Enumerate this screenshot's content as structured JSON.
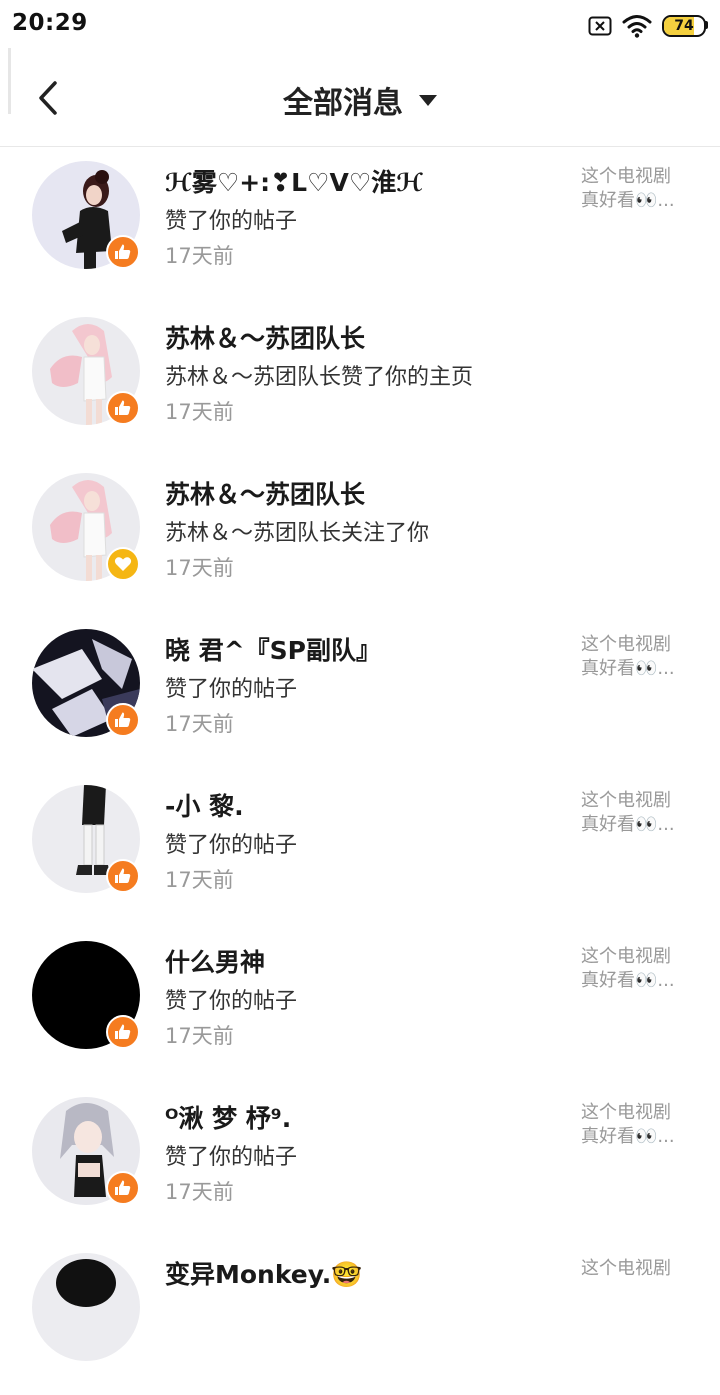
{
  "status_bar": {
    "time": "20:29",
    "battery_level": "74",
    "battery_fraction": 0.74
  },
  "header": {
    "title": "全部消息"
  },
  "colors": {
    "like_badge": "#f57c20",
    "follow_badge": "#f5b614"
  },
  "messages": [
    {
      "name": "ℋ雾♡+:❣L♡V♡淮ℋ",
      "action": "赞了你的帖子",
      "time": "17天前",
      "badge": "thumbs-up-icon",
      "preview_line1": "这个电视剧",
      "preview_line2": "真好看👀..."
    },
    {
      "name": "苏林＆～苏团队长",
      "action": "苏林＆～苏团队长赞了你的主页",
      "time": "17天前",
      "badge": "thumbs-up-icon",
      "preview_line1": "",
      "preview_line2": ""
    },
    {
      "name": "苏林＆～苏团队长",
      "action": "苏林＆～苏团队长关注了你",
      "time": "17天前",
      "badge": "heart-icon",
      "preview_line1": "",
      "preview_line2": ""
    },
    {
      "name": "晓 君^『SP副队』",
      "action": "赞了你的帖子",
      "time": "17天前",
      "badge": "thumbs-up-icon",
      "preview_line1": "这个电视剧",
      "preview_line2": "真好看👀..."
    },
    {
      "name": "-小 黎.",
      "action": "赞了你的帖子",
      "time": "17天前",
      "badge": "thumbs-up-icon",
      "preview_line1": "这个电视剧",
      "preview_line2": "真好看👀..."
    },
    {
      "name": "什么男神",
      "action": "赞了你的帖子",
      "time": "17天前",
      "badge": "thumbs-up-icon",
      "preview_line1": "这个电视剧",
      "preview_line2": "真好看👀..."
    },
    {
      "name": "ᴼ湫 梦 杼⁹.",
      "action": "赞了你的帖子",
      "time": "17天前",
      "badge": "thumbs-up-icon",
      "preview_line1": "这个电视剧",
      "preview_line2": "真好看👀..."
    },
    {
      "name": "变异Monkey.🤓",
      "action": "",
      "time": "",
      "badge": "thumbs-up-icon",
      "preview_line1": "这个电视剧",
      "preview_line2": ""
    }
  ]
}
